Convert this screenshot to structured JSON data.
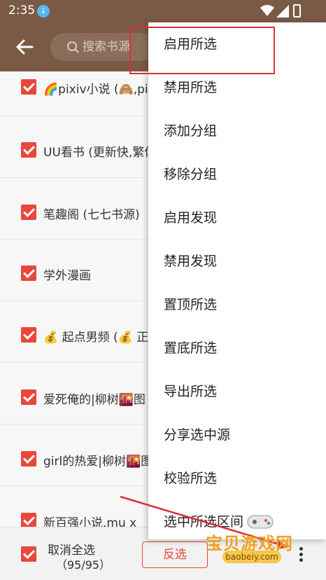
{
  "status_bar": {
    "time": "2:35"
  },
  "toolbar": {
    "search_placeholder": "搜索书源"
  },
  "sources": [
    {
      "name": "🌈pixiv小说 (🙈,pix"
    },
    {
      "name": "UU看书 (更新快,繁体"
    },
    {
      "name": "笔趣阁 (七七书源)"
    },
    {
      "name": "学外漫画"
    },
    {
      "name": "💰 起点男频 (💰 正"
    },
    {
      "name": "爱死俺的|柳树🌇图"
    },
    {
      "name": "girl的热爱|柳树🌇图"
    },
    {
      "name": "新百强小说.mu x"
    }
  ],
  "bottom_bar": {
    "select_label": "取消全选",
    "select_count": "（95/95）",
    "invert_label": "反选"
  },
  "menu": {
    "items": [
      "启用所选",
      "禁用所选",
      "添加分组",
      "移除分组",
      "启用发现",
      "禁用发现",
      "置顶所选",
      "置底所选",
      "导出所选",
      "分享选中源",
      "校验所选",
      "选中所选区间"
    ]
  },
  "watermark": {
    "text": "宝贝游戏网",
    "url": "baobeiy.com"
  },
  "colors": {
    "toolbar": "#7a5a45",
    "accent": "#e8473c",
    "annotation": "#d9303a"
  }
}
